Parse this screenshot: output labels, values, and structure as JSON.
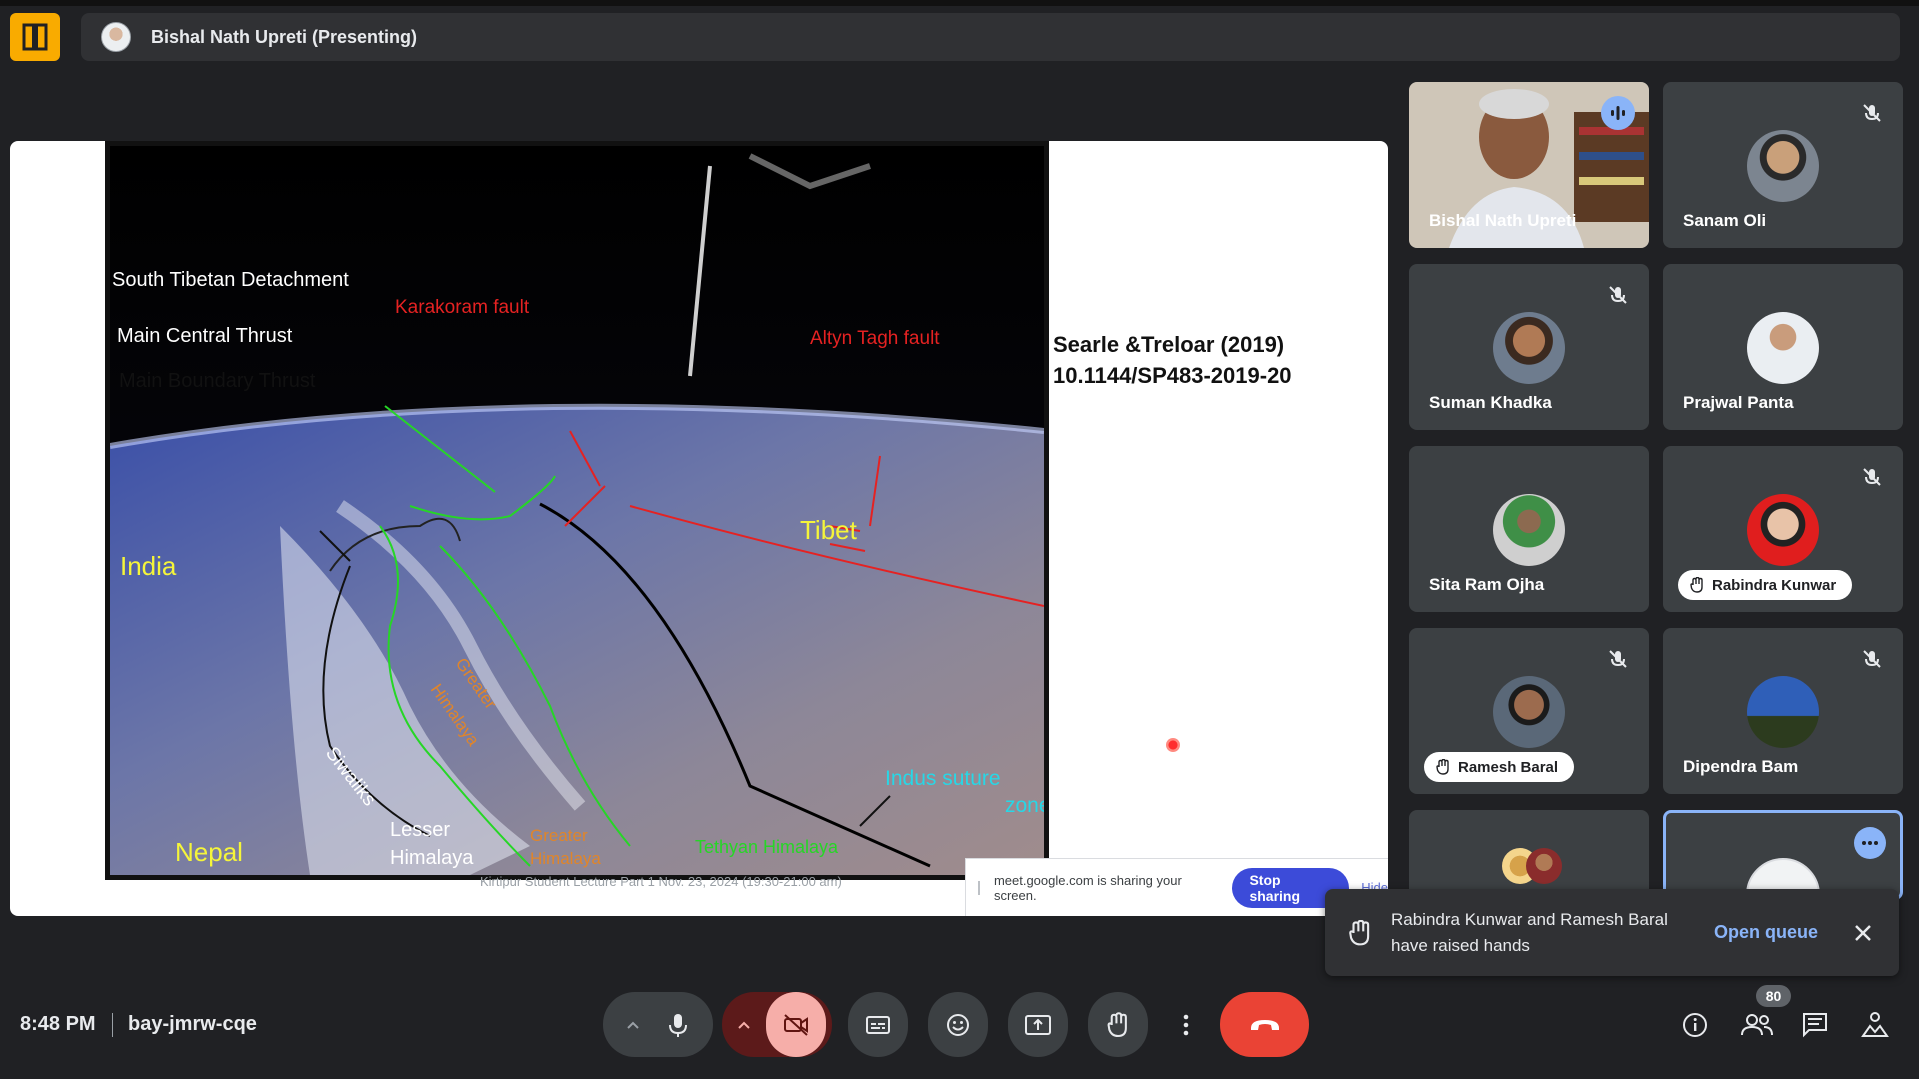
{
  "presenter_bar": {
    "name": "Bishal Nath Upreti (Presenting)"
  },
  "slide": {
    "labels": {
      "std": "South Tibetan Detachment",
      "mct": "Main Central Thrust",
      "mbt": "Main Boundary Thrust",
      "karakoram": "Karakoram fault",
      "altyn": "Altyn Tagh fault",
      "tibet": "Tibet",
      "india": "India",
      "nepal": "Nepal",
      "siwaliks": "Siwaliks",
      "lesser1": "Lesser",
      "lesser2": "Himalaya",
      "greater1": "Greater",
      "greater2": "Himalaya",
      "greater3": "Greater",
      "greater4": "Himalaya",
      "tethyan": "Tethyan Himalaya",
      "indus1": "Indus suture",
      "indus2": "zone"
    },
    "citation_line1": "Searle &Treloar (2019)",
    "citation_line2": "10.1144/SP483-2019-20",
    "footer_caption": "Kirtipur Student Lecture  Part 1 Nov. 23, 2024 (19:30-21:00 am)"
  },
  "share_bar": {
    "message": "meet.google.com is sharing your screen.",
    "stop_label": "Stop sharing",
    "hide_label": "Hide"
  },
  "participants": [
    {
      "name": "Bishal Nath Upreti",
      "state": "speaking"
    },
    {
      "name": "Sanam Oli",
      "state": "muted"
    },
    {
      "name": "Suman Khadka",
      "state": "muted"
    },
    {
      "name": "Prajwal Panta",
      "state": ""
    },
    {
      "name": "Sita Ram Ojha",
      "state": ""
    },
    {
      "name": "Rabindra Kunwar",
      "state": "hand-raised muted"
    },
    {
      "name": "Ramesh Baral",
      "state": "hand-raised muted"
    },
    {
      "name": "Dipendra Bam",
      "state": "muted"
    }
  ],
  "toast": {
    "message": "Rabindra Kunwar and Ramesh Baral have raised hands",
    "action": "Open queue"
  },
  "bottom_bar": {
    "time": "8:48 PM",
    "meeting_code": "bay-jmrw-cqe",
    "people_count": "80"
  },
  "colors": {
    "background": "#202124",
    "tile": "#3c4043",
    "accent_blue": "#8ab4f8",
    "leave_red": "#ea4335",
    "stop_sharing": "#3c4bd9",
    "app_logo": "#f9ab00"
  },
  "icons": [
    "app-logo-icon",
    "mic-off-icon",
    "speaking-icon",
    "more-icon",
    "raised-hand-icon",
    "close-icon",
    "chevron-up-icon",
    "camera-off-icon",
    "captions-icon",
    "emoji-icon",
    "present-icon",
    "raise-hand-icon",
    "more-vert-icon",
    "call-end-icon",
    "info-icon",
    "people-icon",
    "chat-icon",
    "activities-icon"
  ]
}
